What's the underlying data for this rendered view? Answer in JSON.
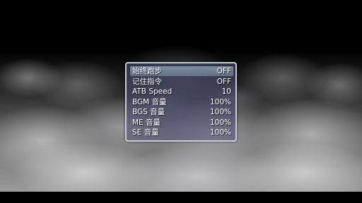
{
  "options_menu": {
    "items": [
      {
        "label": "始终跑步",
        "value": "OFF",
        "selected": true
      },
      {
        "label": "记住指令",
        "value": "OFF",
        "selected": false
      },
      {
        "label": "ATB Speed",
        "value": "10",
        "selected": false
      },
      {
        "label": "BGM 音量",
        "value": "100%",
        "selected": false
      },
      {
        "label": "BGS 音量",
        "value": "100%",
        "selected": false
      },
      {
        "label": "ME 音量",
        "value": "100%",
        "selected": false
      },
      {
        "label": "SE 音量",
        "value": "100%",
        "selected": false
      }
    ]
  },
  "colors": {
    "window_border": "#c9cdd6",
    "text": "#ffffff",
    "background": "#000000"
  }
}
